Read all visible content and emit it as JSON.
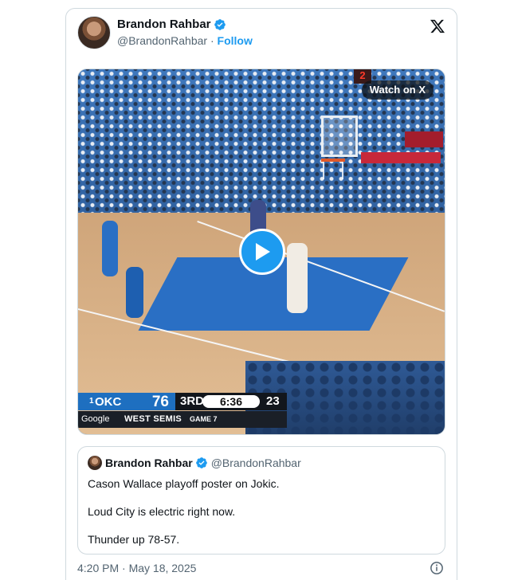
{
  "author": {
    "name": "Brandon Rahbar",
    "handle": "@BrandonRahbar",
    "separator": "·",
    "follow_label": "Follow"
  },
  "media": {
    "watch_label": "Watch on X",
    "shot_clock": "2",
    "scoreboard": {
      "seed": "1",
      "team": "OKC",
      "team_score": "76",
      "period": "3RD",
      "clock": "6:36",
      "opponent_score": "23",
      "sponsor": "Google",
      "round": "WEST SEMIS",
      "game": "GAME 7"
    }
  },
  "quote": {
    "name": "Brandon Rahbar",
    "handle": "@BrandonRahbar",
    "lines": [
      "Cason Wallace playoff poster on Jokic.",
      "Loud City is electric right now.",
      "Thunder up 78-57."
    ]
  },
  "timestamp": "4:20 PM · May 18, 2025",
  "colors": {
    "accent": "#1d9bf0",
    "okc_blue": "#1e6fc0",
    "border": "#cfd9de"
  },
  "icons": {
    "verified": "verified-badge-icon",
    "brand": "x-logo-icon",
    "play": "play-icon",
    "info": "info-icon"
  }
}
